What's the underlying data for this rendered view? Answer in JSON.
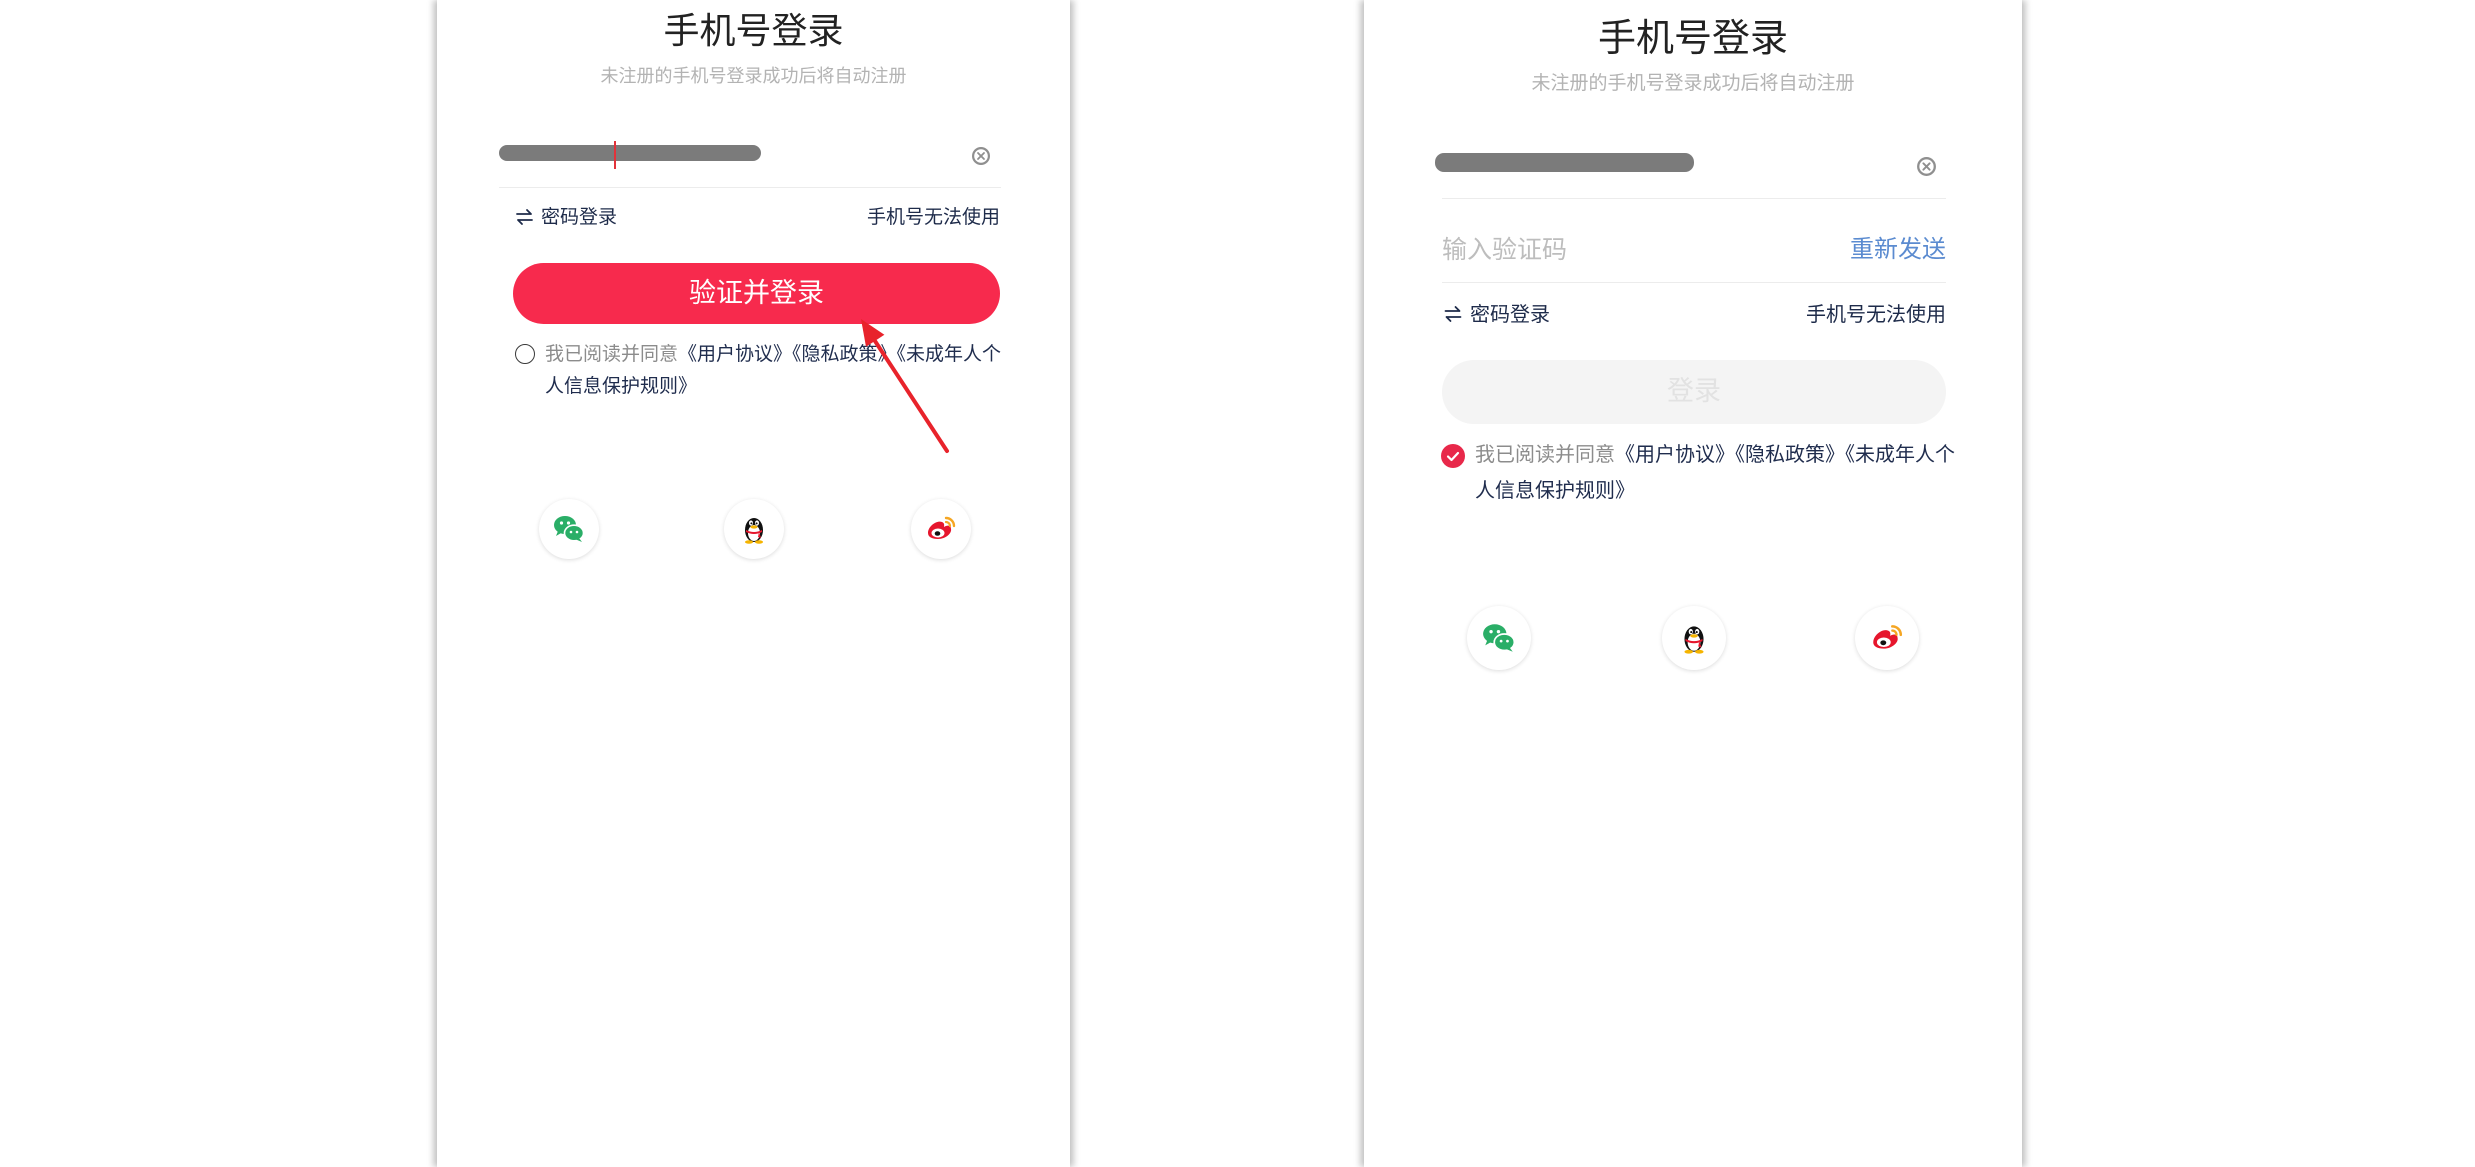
{
  "login_screens": [
    {
      "title": "手机号登录",
      "subtitle": "未注册的手机号登录成功后将自动注册",
      "password_login_label": "密码登录",
      "phone_unavailable_label": "手机号无法使用",
      "submit_label": "验证并登录",
      "submit_enabled": true,
      "agreement": {
        "checked": false,
        "prefix": "我已阅读并同意",
        "user_agreement": "《用户协议》",
        "privacy_policy": "《隐私政策》",
        "minor_rules": "《未成年人个人信息保护规则》"
      },
      "social_icons": [
        "wechat-icon",
        "qq-icon",
        "weibo-icon"
      ]
    },
    {
      "title": "手机号登录",
      "subtitle": "未注册的手机号登录成功后将自动注册",
      "code_placeholder": "输入验证码",
      "resend_label": "重新发送",
      "password_login_label": "密码登录",
      "phone_unavailable_label": "手机号无法使用",
      "submit_label": "登录",
      "submit_enabled": false,
      "agreement": {
        "checked": true,
        "prefix": "我已阅读并同意",
        "user_agreement": "《用户协议》",
        "privacy_policy": "《隐私政策》",
        "minor_rules": "《未成年人个人信息保护规则》"
      },
      "social_icons": [
        "wechat-icon",
        "qq-icon",
        "weibo-icon"
      ]
    }
  ],
  "icons": {
    "clear": "clear-circle-icon",
    "swap": "swap-arrows-icon",
    "checkbox_checked": "check-icon"
  },
  "colors": {
    "primary_button": "#f72a4d",
    "disabled_button": "#f4f4f4",
    "link": "#1f2c4d",
    "resend": "#5b8bd0",
    "annotation_arrow": "#e8232b",
    "wechat": "#2aae67",
    "weibo": "#e6162d"
  }
}
